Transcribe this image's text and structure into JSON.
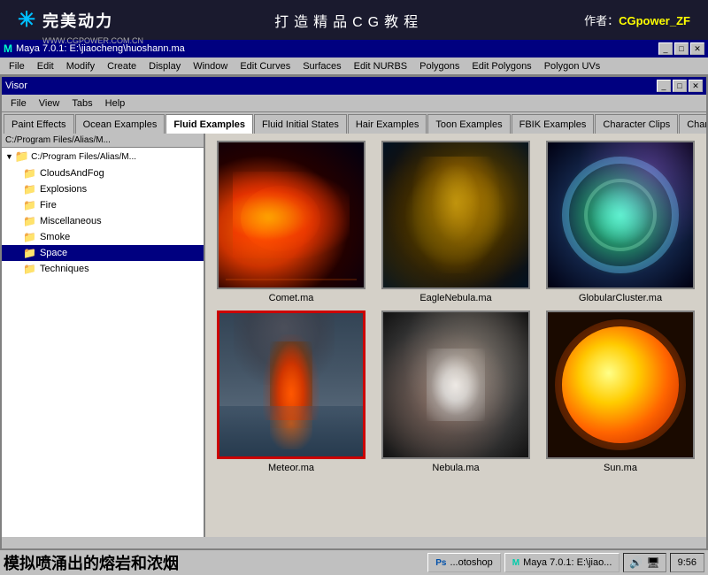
{
  "banner": {
    "logo_symbol": "✳",
    "logo_cn": "完美动力",
    "logo_url": "WWW.CGPOWER.COM.CN",
    "title": "打造精品CG教程",
    "author_label": "作者：",
    "author_name": "CGpower_ZF"
  },
  "maya_titlebar": {
    "title": "Maya 7.0.1: E:\\jiaocheng\\huoshann.ma",
    "btn_min": "_",
    "btn_max": "□",
    "btn_close": "✕"
  },
  "menu_bar": {
    "items": [
      "File",
      "Edit",
      "Modify",
      "Create",
      "Display",
      "Window",
      "Edit Curves",
      "Surfaces",
      "Edit NURBS",
      "Polygons",
      "Edit Polygons",
      "Polygon UVs"
    ]
  },
  "visor": {
    "title": "Visor",
    "menu_items": [
      "File",
      "View",
      "Tabs",
      "Help"
    ],
    "tabs": [
      {
        "label": "Paint Effects",
        "active": false
      },
      {
        "label": "Ocean Examples",
        "active": false
      },
      {
        "label": "Fluid Examples",
        "active": true
      },
      {
        "label": "Fluid Initial States",
        "active": false
      },
      {
        "label": "Hair Examples",
        "active": false
      },
      {
        "label": "Toon Examples",
        "active": false
      },
      {
        "label": "FBIK Examples",
        "active": false
      },
      {
        "label": "Character Clips",
        "active": false
      },
      {
        "label": "Character Poses",
        "active": false
      }
    ],
    "scroll_left": "◄",
    "scroll_right": "►"
  },
  "file_tree": {
    "path": "C:/Program Files/Alias/M...",
    "root": "C:/Program Files/Alias/M...",
    "items": [
      {
        "label": "CloudsAndFog",
        "selected": false
      },
      {
        "label": "Explosions",
        "selected": false
      },
      {
        "label": "Fire",
        "selected": false
      },
      {
        "label": "Miscellaneous",
        "selected": false
      },
      {
        "label": "Smoke",
        "selected": false
      },
      {
        "label": "Space",
        "selected": true
      },
      {
        "label": "Techniques",
        "selected": false
      }
    ]
  },
  "thumbnails": [
    {
      "label": "Comet.ma",
      "type": "comet",
      "selected": false
    },
    {
      "label": "EagleNebula.ma",
      "type": "eagle",
      "selected": false
    },
    {
      "label": "GlobularCluster.ma",
      "type": "globular",
      "selected": false
    },
    {
      "label": "Meteor.ma",
      "type": "meteor",
      "selected": true
    },
    {
      "label": "Nebula.ma",
      "type": "nebula",
      "selected": false
    },
    {
      "label": "Sun.ma",
      "type": "sun",
      "selected": false
    }
  ],
  "status_bar": {
    "text": "模拟喷涌出的熔岩和浓烟",
    "taskbar_items": [
      {
        "label": "Photoshop",
        "icon": "PS"
      },
      {
        "label": "Maya 7.0.1: E:\\jiao...",
        "icon": "M"
      }
    ],
    "clock": "9:56",
    "tray_icons": [
      "🔊",
      "🖧"
    ]
  }
}
